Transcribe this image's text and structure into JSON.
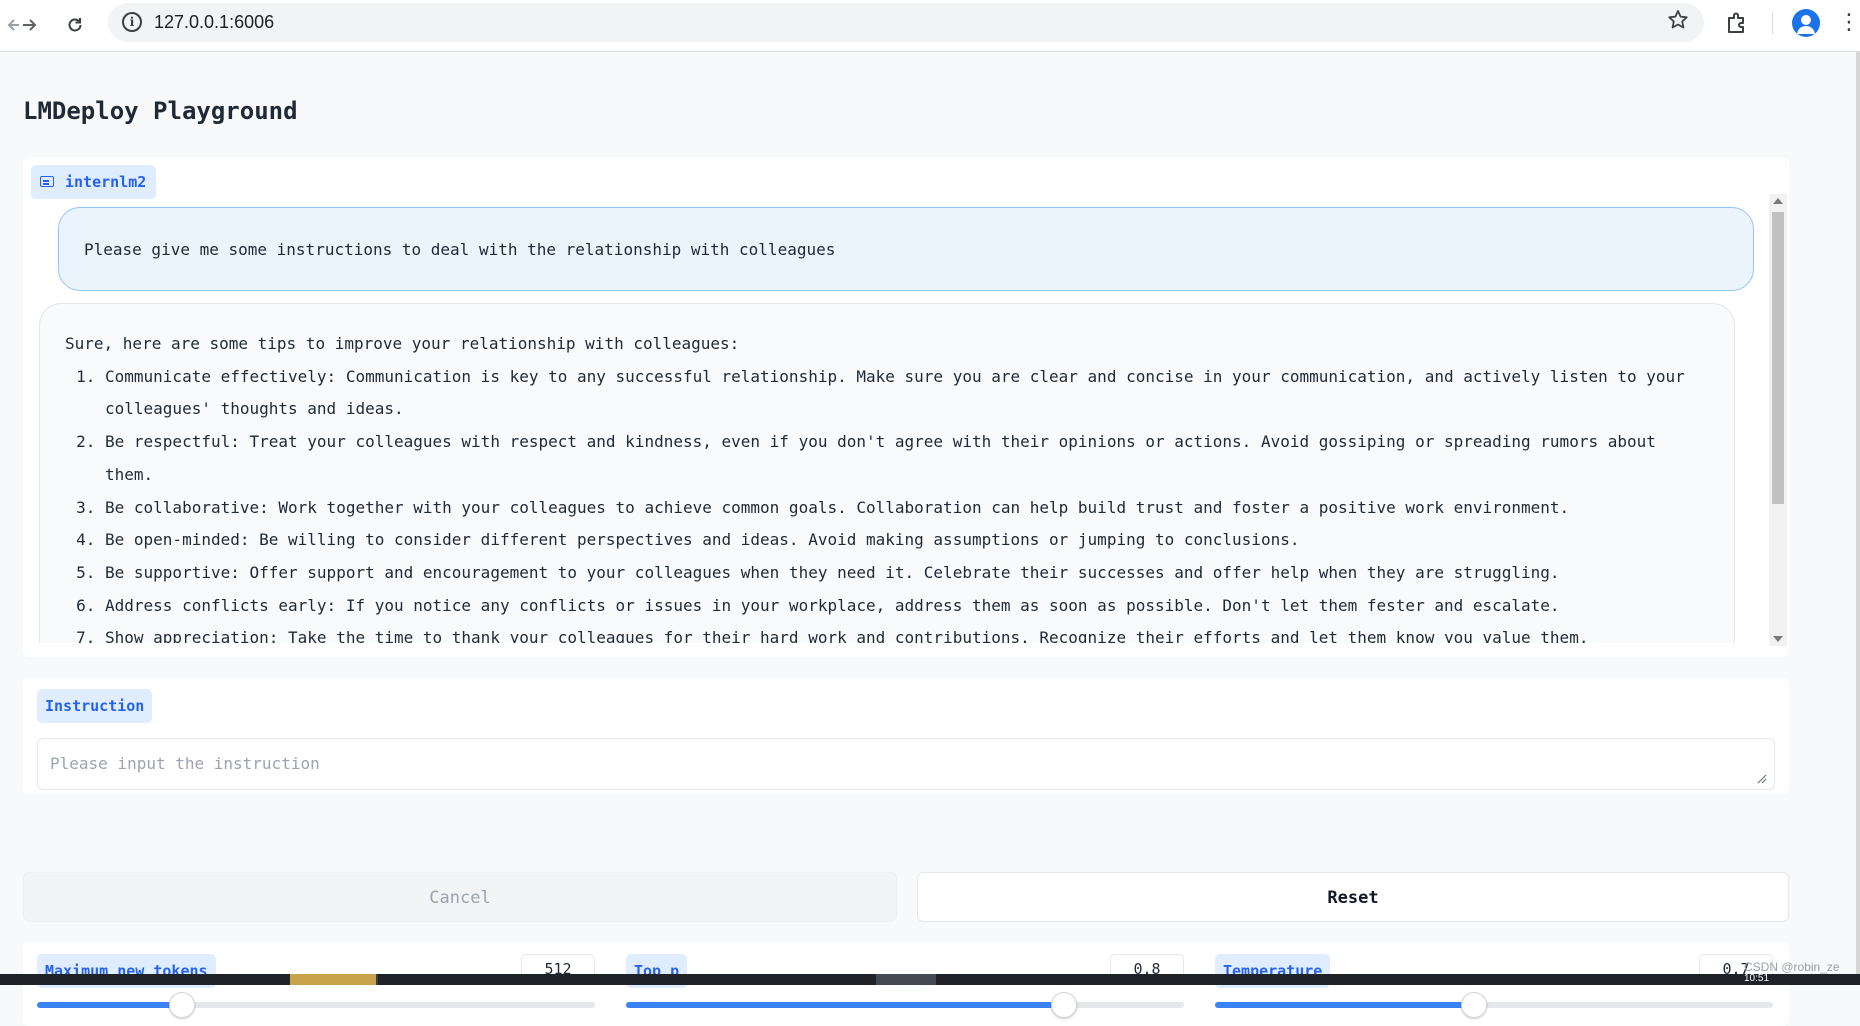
{
  "browser": {
    "url": "127.0.0.1:6006",
    "back_icon": "arrow-left-icon",
    "forward_icon": "arrow-right-icon",
    "reload_icon": "reload-icon",
    "bookmark_icon": "star-icon",
    "extensions_icon": "puzzle-icon",
    "profile_icon": "person-icon",
    "menu_icon": "more-vertical-icon"
  },
  "page": {
    "title": "LMDeploy Playground"
  },
  "chatbot": {
    "model_label": "internlm2",
    "user_message": "Please give me some instructions to deal with the relationship with colleagues",
    "bot_intro": "Sure, here are some tips to improve your relationship with colleagues:",
    "bot_items": [
      "Communicate effectively: Communication is key to any successful relationship. Make sure you are clear and concise in your communication, and actively listen to your colleagues' thoughts and ideas.",
      "Be respectful: Treat your colleagues with respect and kindness, even if you don't agree with their opinions or actions. Avoid gossiping or spreading rumors about them.",
      "Be collaborative: Work together with your colleagues to achieve common goals. Collaboration can help build trust and foster a positive work environment.",
      "Be open-minded: Be willing to consider different perspectives and ideas. Avoid making assumptions or jumping to conclusions.",
      "Be supportive: Offer support and encouragement to your colleagues when they need it. Celebrate their successes and offer help when they are struggling.",
      "Address conflicts early: If you notice any conflicts or issues in your workplace, address them as soon as possible. Don't let them fester and escalate.",
      "Show appreciation: Take the time to thank your colleagues for their hard work and contributions. Recognize their efforts and let them know you value them."
    ]
  },
  "instruction": {
    "label": "Instruction",
    "placeholder": "Please input the instruction",
    "value": ""
  },
  "buttons": {
    "cancel": "Cancel",
    "reset": "Reset"
  },
  "params": [
    {
      "label": "Maximum new tokens",
      "value": "512",
      "fraction": 0.26
    },
    {
      "label": "Top_p",
      "value": "0.8",
      "fraction": 0.785
    },
    {
      "label": "Temperature",
      "value": "0.7",
      "fraction": 0.465
    }
  ],
  "watermark": "CSDN @robin_ze",
  "taskbar": {
    "clock": "10:51"
  }
}
